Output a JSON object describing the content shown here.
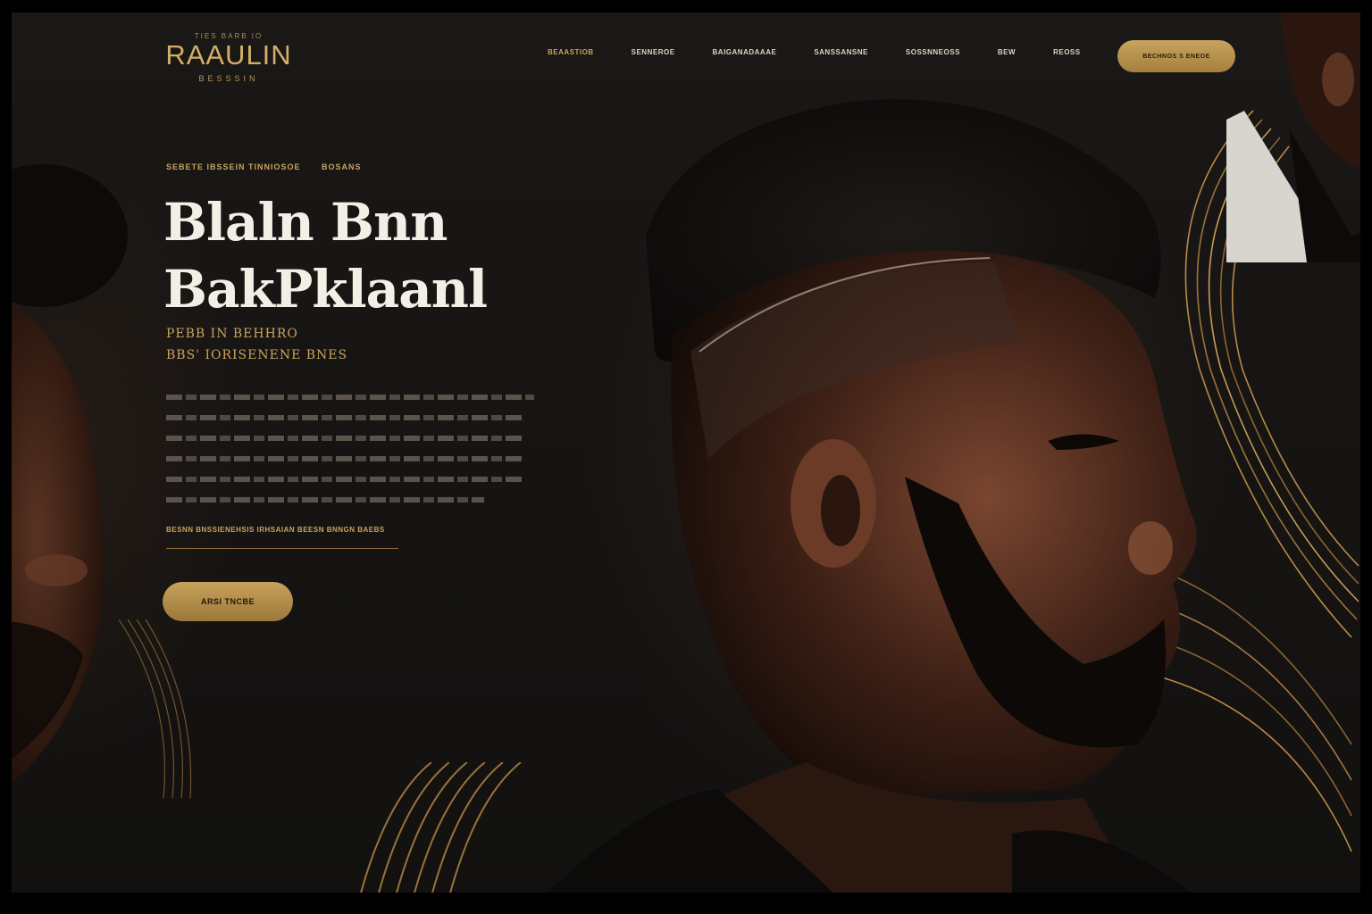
{
  "brand": {
    "top_line": "TIES  BARB  IO",
    "name": "RAAULIN",
    "sub_line": "BESSSIN"
  },
  "nav": {
    "items": [
      "BEAASTIOB",
      "SENNEROE",
      "BAIGANADAAAE",
      "SANSSANSNE",
      "SOSSNNEOSS",
      "BEW",
      "REOSS"
    ],
    "cta_label": "BECHNOS S ENEOE"
  },
  "hero": {
    "eyebrow_left": "SEBETE IBSSEIN TINNIOSOE",
    "eyebrow_right": "BOSANS",
    "headline_line1": "Blaln Bnn",
    "headline_line2": "BakPklaanl",
    "subhead_line1": "PEBB IN BEHHRO",
    "subhead_line2": "BBS' IORISENENE BNES",
    "body_lines": 6,
    "link_text": "BESNN  BNSSIENEHSIS IRHSAIAN  BEESN  BNNGN  BAEBS",
    "cta_label": "ARSI TNCBE"
  },
  "colors": {
    "gold": "#c9a35c",
    "background": "#161412",
    "headline": "#f4efe6"
  }
}
